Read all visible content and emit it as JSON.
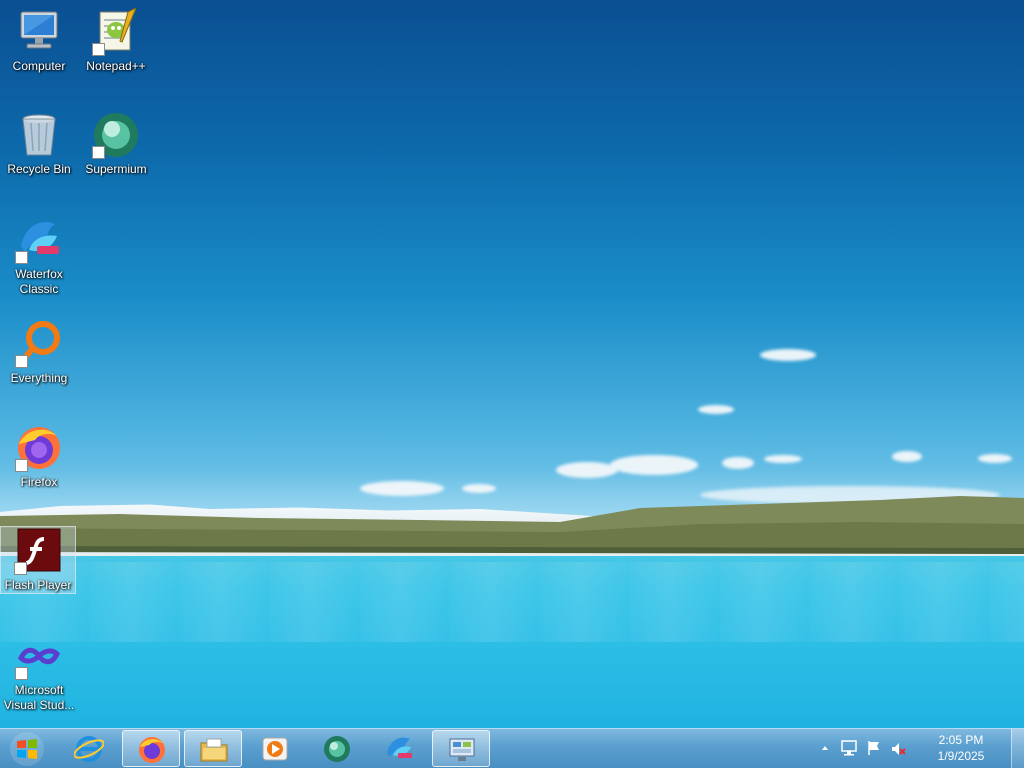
{
  "desktop": {
    "icons": [
      {
        "label": "Computer",
        "icon": "computer-icon"
      },
      {
        "label": "Notepad++",
        "icon": "notepadpp-icon"
      },
      {
        "label": "Recycle Bin",
        "icon": "recycle-bin-icon"
      },
      {
        "label": "Supermium",
        "icon": "supermium-icon"
      },
      {
        "label": "Waterfox Classic",
        "icon": "waterfox-icon"
      },
      {
        "label": "Everything",
        "icon": "everything-icon"
      },
      {
        "label": "Firefox",
        "icon": "firefox-icon"
      },
      {
        "label": "Flash Player",
        "icon": "flash-player-icon",
        "selected": true
      },
      {
        "label": "Microsoft Visual Stud...",
        "icon": "visual-studio-icon"
      }
    ]
  },
  "taskbar": {
    "start_icon": "windows-logo-icon",
    "buttons": [
      {
        "icon": "internet-explorer-icon",
        "active": false
      },
      {
        "icon": "firefox-icon",
        "active": true
      },
      {
        "icon": "file-explorer-icon",
        "active": true
      },
      {
        "icon": "media-player-icon",
        "active": false
      },
      {
        "icon": "supermium-icon",
        "active": false
      },
      {
        "icon": "waterfox-icon",
        "active": false
      },
      {
        "icon": "control-panel-icon",
        "active": true
      }
    ],
    "tray": {
      "icons": [
        "show-hidden-icons-chevron",
        "network-icon",
        "action-center-flag-icon",
        "volume-muted-icon"
      ],
      "time": "2:05 PM",
      "date": "1/9/2025"
    }
  },
  "colors": {
    "taskbar": "#5a9fcf",
    "sky_top": "#0a4f92",
    "water": "#2cbde6"
  }
}
